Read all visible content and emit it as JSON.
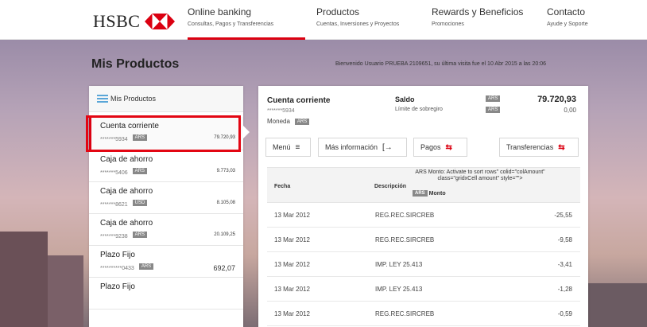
{
  "brand": {
    "name": "HSBC"
  },
  "nav": [
    {
      "title": "Online banking",
      "subtitle": "Consultas, Pagos y Transferencias"
    },
    {
      "title": "Productos",
      "subtitle": "Cuentas, Inversiones y Proyectos"
    },
    {
      "title": "Rewards y Beneficios",
      "subtitle": "Promociones"
    },
    {
      "title": "Contacto",
      "subtitle": "Ayude y Soporte"
    }
  ],
  "page": {
    "title": "Mis Productos",
    "welcome": "Bienvenido Usuario PRUEBA 2109651, su última visita fue el 10 Abr 2015 a las 20:06"
  },
  "products": {
    "header": "Mis Productos",
    "items": [
      {
        "name": "Cuenta corriente",
        "account": "*******5934",
        "currency": "ARS",
        "amount": "79.720,93"
      },
      {
        "name": "Caja de ahorro",
        "account": "*******5406",
        "currency": "ARS",
        "amount": "9.773,03"
      },
      {
        "name": "Caja de ahorro",
        "account": "*******8621",
        "currency": "USD",
        "amount": "8.105,08"
      },
      {
        "name": "Caja de ahorro",
        "account": "*******9238",
        "currency": "ARS",
        "amount": "20.109,25"
      },
      {
        "name": "Plazo Fijo",
        "account": "**********0433",
        "currency": "ARS",
        "amount": "692,07"
      },
      {
        "name": "Plazo Fijo",
        "account": "",
        "currency": "",
        "amount": ""
      }
    ]
  },
  "detail": {
    "title": "Cuenta corriente",
    "account": "*******5934",
    "currency_label": "Moneda",
    "currency": "ARS",
    "saldo_label": "Saldo",
    "limite_label": "Límite de sobregiro",
    "saldo_currency": "ARS",
    "limite_currency": "ARS",
    "saldo": "79.720,93",
    "limite": "0,00"
  },
  "actions": {
    "menu": "Menú",
    "more_info": "Más información",
    "pagos": "Pagos",
    "transferencias": "Transferencias"
  },
  "table": {
    "col_fecha": "Fecha",
    "col_desc": "Descripción",
    "col_monto_leak": "ARS Monto: Activate to sort rows\" colid=\"colAmount\" class=\"gridxCell amount\" style=\"\">",
    "col_monto_currency": "ARS",
    "col_monto": "Monto",
    "rows": [
      {
        "fecha": "13 Mar 2012",
        "desc": "REG.REC.SIRCREB",
        "monto": "-25,55"
      },
      {
        "fecha": "13 Mar 2012",
        "desc": "REG.REC.SIRCREB",
        "monto": "-9,58"
      },
      {
        "fecha": "13 Mar 2012",
        "desc": "IMP. LEY 25.413",
        "monto": "-3,41"
      },
      {
        "fecha": "13 Mar 2012",
        "desc": "IMP. LEY 25.413",
        "monto": "-1,28"
      },
      {
        "fecha": "13 Mar 2012",
        "desc": "REG.REC.SIRCREB",
        "monto": "-0,59"
      }
    ]
  },
  "colors": {
    "brand_red": "#db0011",
    "highlight": "#e30613"
  }
}
